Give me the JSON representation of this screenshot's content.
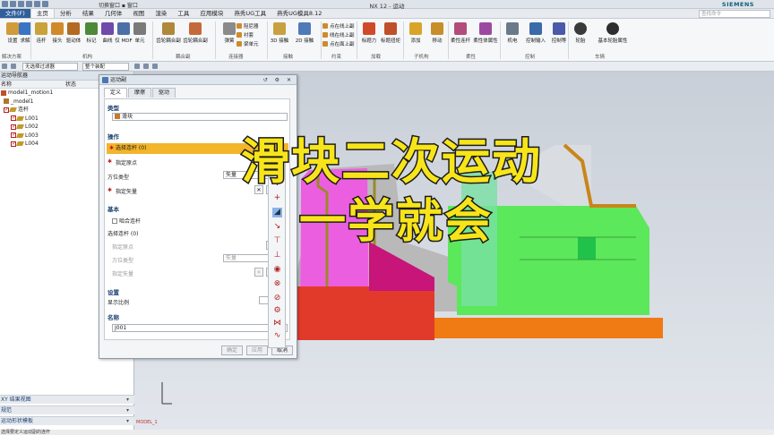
{
  "app": {
    "window_title": "NX 12 - 运动",
    "brand": "SIEMENS",
    "switch_window": "切换窗口",
    "window_menu": "窗口"
  },
  "tabs": [
    {
      "label": "文件(F)"
    },
    {
      "label": "主页"
    },
    {
      "label": "分析"
    },
    {
      "label": "结果"
    },
    {
      "label": "几何体"
    },
    {
      "label": "视图"
    },
    {
      "label": "渲染"
    },
    {
      "label": "工具"
    },
    {
      "label": "应用模块"
    },
    {
      "label": "燕秀UG工具"
    },
    {
      "label": "燕秀UG模具8.12"
    }
  ],
  "search_placeholder": "查找命令",
  "ribbon": {
    "buttons": [
      {
        "label": "设置"
      },
      {
        "label": "求解"
      },
      {
        "label": "连杆"
      },
      {
        "label": "接头"
      },
      {
        "label": "驱动体"
      },
      {
        "label": "标记"
      },
      {
        "label": "曲线"
      },
      {
        "label": "仅 MDF"
      },
      {
        "label": "单元"
      },
      {
        "label": "齿轮耦合副"
      },
      {
        "label": "齿轮耦合副"
      },
      {
        "label": "弹簧"
      },
      {
        "label": "3D 接触"
      },
      {
        "label": "2D 接触"
      },
      {
        "label": "标题力"
      },
      {
        "label": "标题扭矩"
      },
      {
        "label": "添加"
      },
      {
        "label": "移动"
      },
      {
        "label": "柔性连杆"
      },
      {
        "label": "柔性体属性"
      },
      {
        "label": "机电"
      },
      {
        "label": "控制输入"
      },
      {
        "label": "控制等"
      },
      {
        "label": "轮胎"
      },
      {
        "label": "基本轮胎属性"
      }
    ],
    "small": [
      {
        "label": "阻尼器"
      },
      {
        "label": "衬套"
      },
      {
        "label": "梁单元"
      },
      {
        "label": "点在线上副"
      },
      {
        "label": "线在线上副"
      },
      {
        "label": "点在面上副"
      }
    ],
    "groups": [
      {
        "label": "解决方案"
      },
      {
        "label": "机构"
      },
      {
        "label": "耦合副"
      },
      {
        "label": "连接器"
      },
      {
        "label": "接触"
      },
      {
        "label": "约束"
      },
      {
        "label": "加载"
      },
      {
        "label": "子机构"
      },
      {
        "label": "柔性"
      },
      {
        "label": "控制"
      },
      {
        "label": "车辆"
      }
    ]
  },
  "filterbar": {
    "filter_value": "无选择过滤器",
    "assembly_value": "整个装配"
  },
  "navigator": {
    "title": "运动导航器",
    "col_name": "名称",
    "col_status": "状态",
    "items": [
      {
        "label": "model1_motion1"
      },
      {
        "label": "_model1"
      },
      {
        "label": "连杆"
      },
      {
        "label": "L001"
      },
      {
        "label": "L002"
      },
      {
        "label": "L003"
      },
      {
        "label": "L004"
      }
    ],
    "bottom_panels": [
      {
        "label": "XY 结果视图"
      },
      {
        "label": "规范"
      },
      {
        "label": "运动形状模板"
      }
    ]
  },
  "dialog": {
    "title": "运动副",
    "tabs": [
      {
        "label": "定义"
      },
      {
        "label": "摩擦"
      },
      {
        "label": "驱动"
      }
    ],
    "type_section": "类型",
    "type_value": "滑块",
    "action_section": "操作",
    "select_link": "选择连杆 (0)",
    "specify_origin": "指定原点",
    "orient_type_label": "方位类型",
    "orient_type_value": "矢量",
    "specify_vector": "指定矢量",
    "base_section": "基本",
    "align_link": "啮合连杆",
    "select_link2": "选择连杆 (0)",
    "specify_origin2": "指定原点",
    "orient_type_label2": "方位类型",
    "orient_type_value2": "矢量",
    "specify_vector2": "指定矢量",
    "settings_section": "设置",
    "display_scale_label": "显示比例",
    "display_scale_value": "1",
    "name_section": "名称",
    "name_value": "J001",
    "ok": "确定",
    "apply": "应用",
    "cancel": "取消"
  },
  "overlay": {
    "line1": "滑块二次运动",
    "line2": "一学就会"
  },
  "canvas_label": "MODEL_1",
  "status_text": "选择要定义运动副的连杆",
  "colors": {
    "caption_fill": "#f7e51a",
    "highlight": "#f3b52a",
    "magenta": "#ec5ee0",
    "green": "#5be85b",
    "red": "#e23a2a",
    "orange": "#f07a14",
    "olive": "#8a9a2a"
  }
}
